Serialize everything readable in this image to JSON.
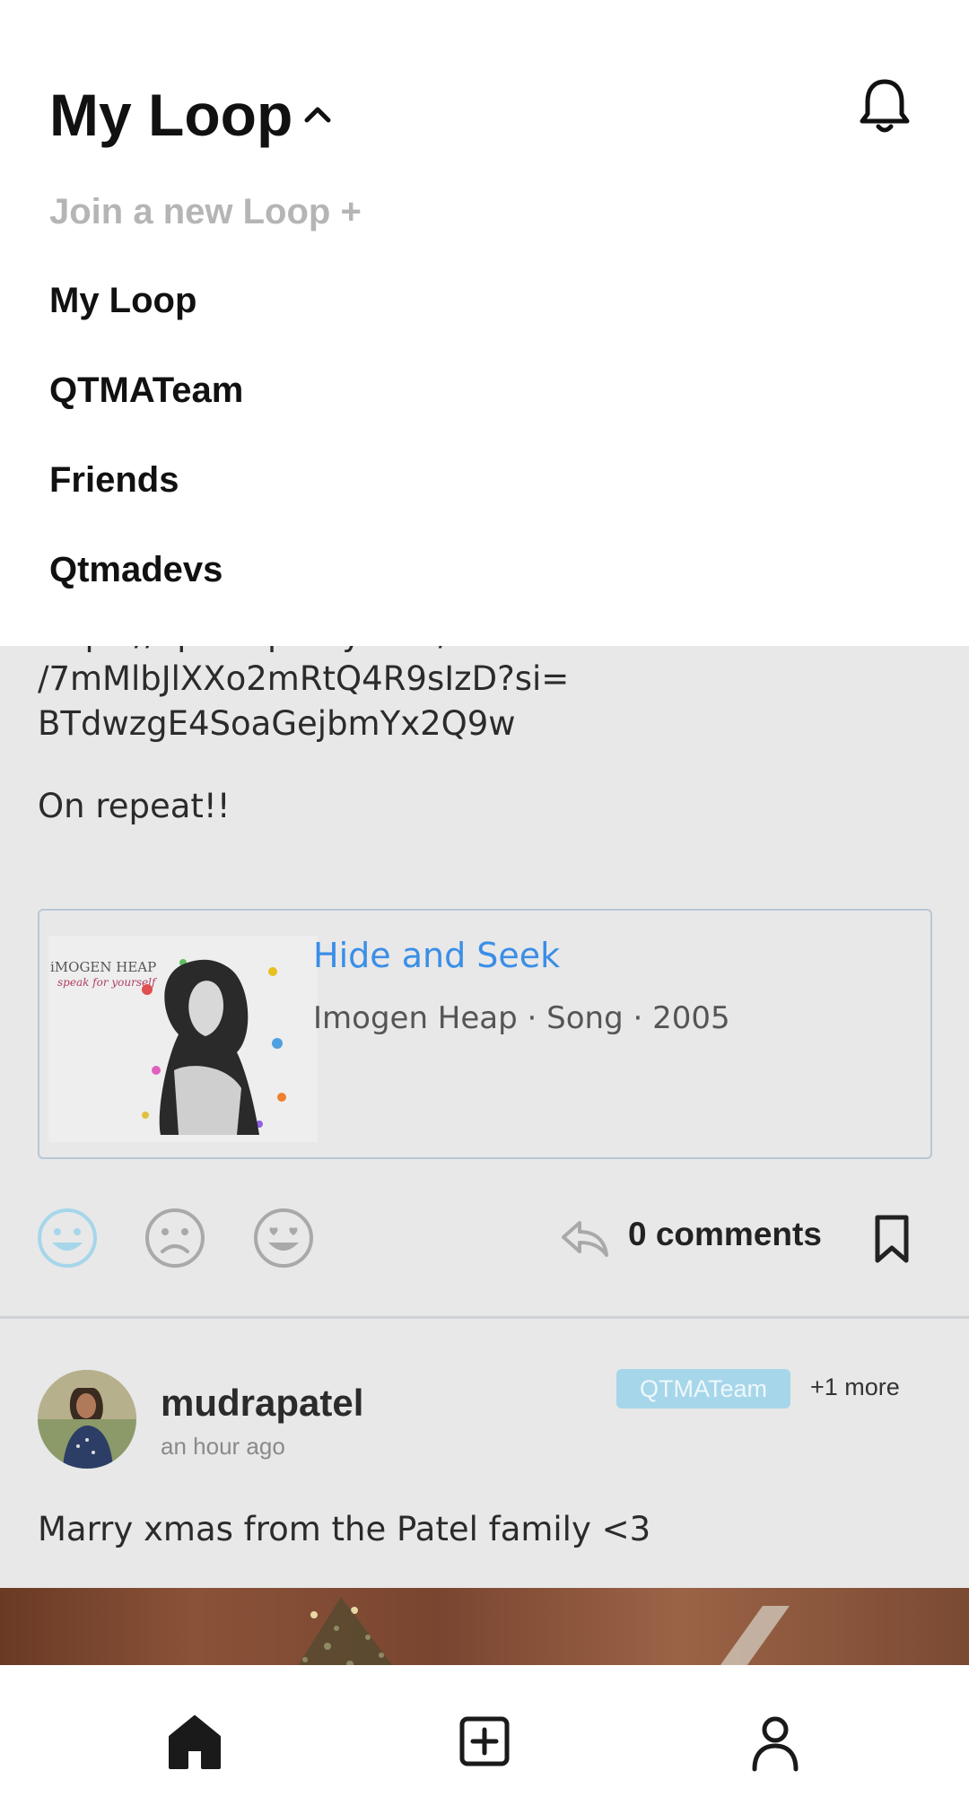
{
  "header": {
    "title": "My Loop"
  },
  "dropdown": {
    "join_label": "Join a new Loop +",
    "loops": [
      "My Loop",
      "QTMATeam",
      "Friends",
      "Qtmadevs"
    ]
  },
  "post1": {
    "text_lines": [
      "https://open.spotify.com/track",
      "/7mMlbJlXXo2mRtQ4R9sIzD?si=",
      "BTdwzgE4SoaGejbmYx2Q9w",
      "On repeat!!"
    ],
    "link_card": {
      "title": "Hide and Seek",
      "meta": "Imogen Heap · Song · 2005",
      "album_text": "iMOGEN HEAP",
      "album_subtext": "speak for yourself"
    },
    "reactions": [
      "smile-icon",
      "sad-icon",
      "heart-eyes-icon"
    ],
    "active_reaction": "smile-icon",
    "comments_label": "0 comments"
  },
  "post2": {
    "username": "mudrapatel",
    "timestamp": "an hour ago",
    "loop_badge": "QTMATeam",
    "more_label": "+1 more",
    "text": "Marry xmas from the Patel family <3"
  },
  "colors": {
    "accent": "#3a8ee6",
    "badge": "#a6d6ea",
    "active_reaction": "#a6d6ea",
    "feed_bg": "#e8e8e9"
  },
  "bottom_nav": {
    "items": [
      "home-icon",
      "add-post-icon",
      "profile-icon"
    ],
    "active": "home-icon"
  }
}
